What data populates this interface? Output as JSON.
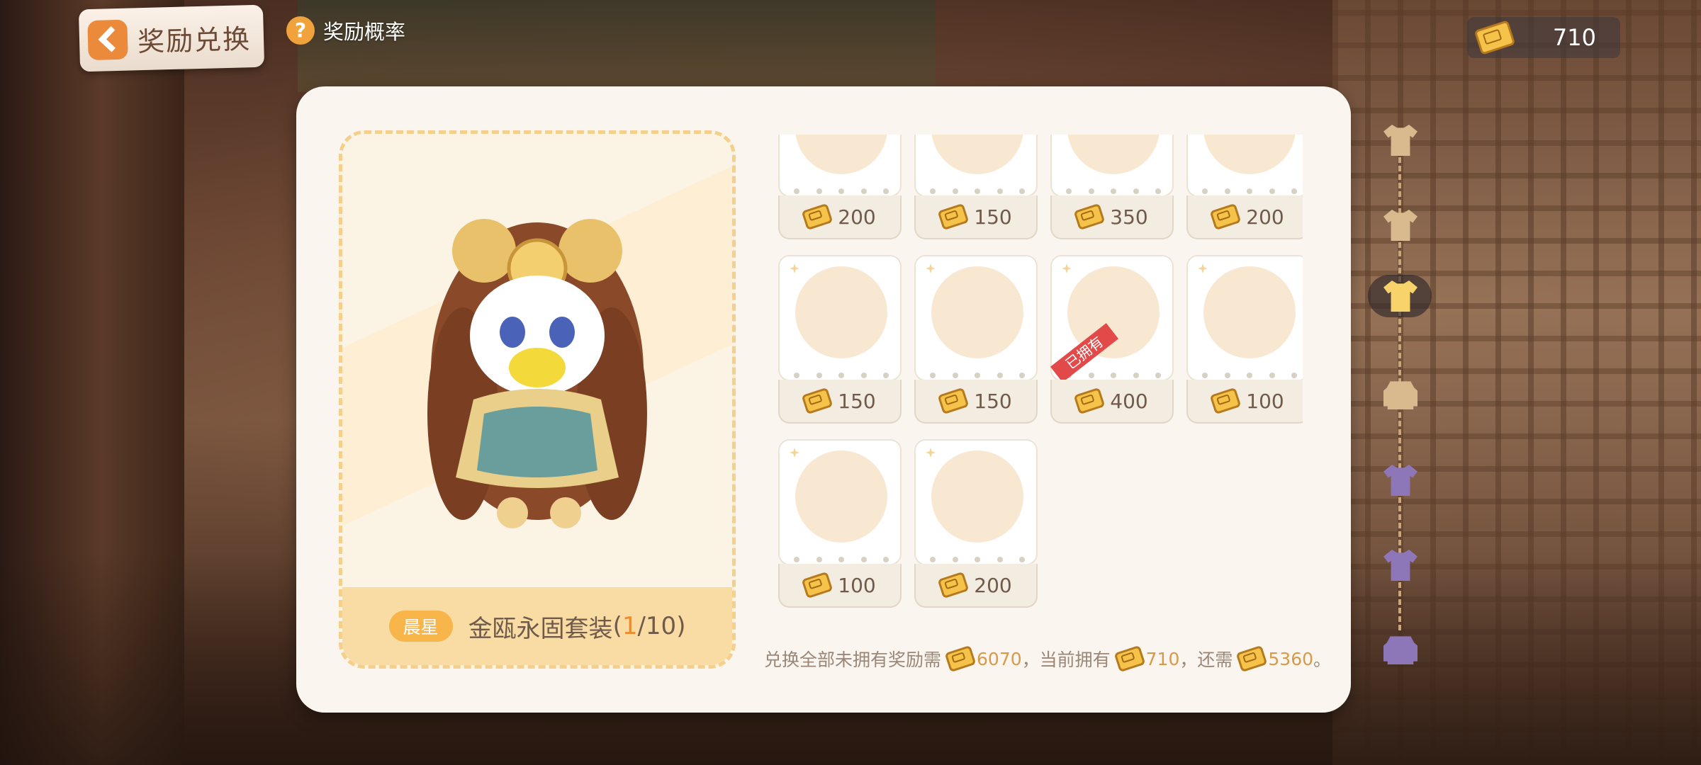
{
  "header": {
    "back_label": "奖励兑换",
    "prob_icon": "question-icon",
    "prob_label": "奖励概率",
    "currency_amount": "710",
    "currency_icon": "ticket-icon"
  },
  "preview": {
    "rarity": "晨星",
    "suit_name": "金瓯永固套装",
    "count_open": "(",
    "count_current": "1",
    "count_rest": "/10)"
  },
  "items": [
    {
      "price": "200",
      "owned": false
    },
    {
      "price": "150",
      "owned": false
    },
    {
      "price": "350",
      "owned": false
    },
    {
      "price": "200",
      "owned": false
    },
    {
      "price": "150",
      "owned": false
    },
    {
      "price": "150",
      "owned": false
    },
    {
      "price": "400",
      "owned": true,
      "owned_label": "已拥有"
    },
    {
      "price": "100",
      "owned": false
    },
    {
      "price": "100",
      "owned": false
    },
    {
      "price": "200",
      "owned": false
    }
  ],
  "summary": {
    "text1": "兑换全部未拥有奖励需",
    "need": "6070",
    "text2": "，当前拥有",
    "have": "710",
    "text3": "，还需",
    "remain": "5360",
    "text4": "。"
  },
  "rail": [
    {
      "icon": "shirt-icon",
      "color": "#d9b98e"
    },
    {
      "icon": "shirt-icon",
      "color": "#d9b98e"
    },
    {
      "icon": "shirt-icon",
      "color": "#f7d36a",
      "active": true
    },
    {
      "icon": "sofa-icon",
      "color": "#d9b98e"
    },
    {
      "icon": "shirt-icon",
      "color": "#8e77b8"
    },
    {
      "icon": "shirt-icon",
      "color": "#8e77b8"
    },
    {
      "icon": "sofa-icon",
      "color": "#8e77b8"
    }
  ],
  "colors": {
    "accent_orange": "#ef8a2f",
    "panel_bg": "#faf6ef",
    "ticket_gold": "#f6c34a",
    "owned_red": "#e24a4a"
  }
}
